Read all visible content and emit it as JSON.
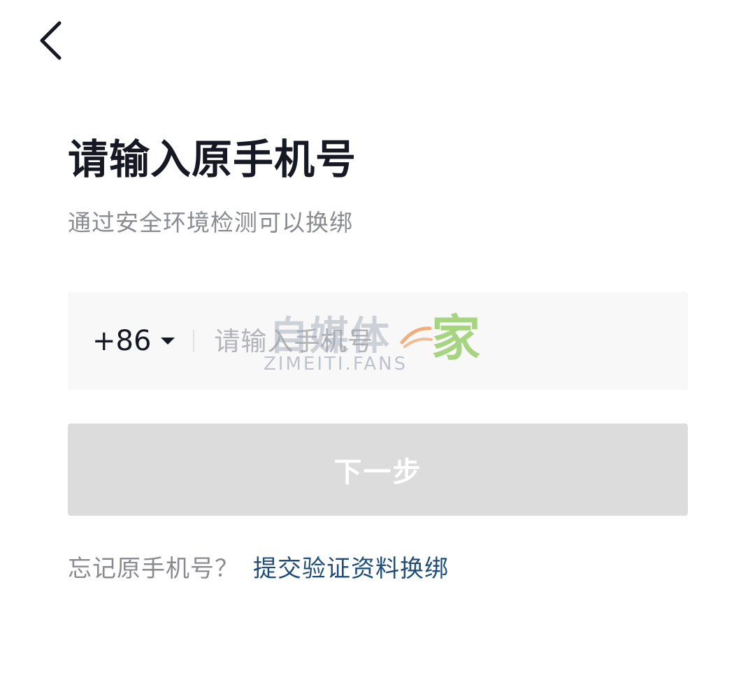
{
  "header": {
    "back_icon": "chevron-left-icon"
  },
  "page": {
    "title": "请输入原手机号",
    "subtitle": "通过安全环境检测可以换绑"
  },
  "phone_input": {
    "country_code": "+86",
    "dropdown_icon": "caret-down-icon",
    "placeholder": "请输入手机号",
    "value": ""
  },
  "next_button": {
    "label": "下一步",
    "state": "disabled",
    "background": "#dcdcdd"
  },
  "forgot": {
    "prompt": "忘记原手机号？",
    "link_label": "提交验证资料换绑",
    "link_color": "#1f4e7a"
  },
  "watermark": {
    "main": "自媒体",
    "home": "家",
    "sub": "ZIMEITI.FANS"
  }
}
